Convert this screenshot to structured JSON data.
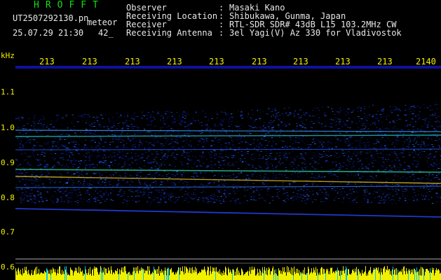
{
  "header": {
    "station_title": "HROFFT",
    "file_name": "UT2507292130.pn",
    "type_label": "meteor",
    "date_time": "25.07.29 21:30",
    "count": "42_"
  },
  "info": [
    {
      "label": "Observer",
      "value": "Masaki Kano"
    },
    {
      "label": "Receiving Location",
      "value": "Shibukawa, Gunma, Japan"
    },
    {
      "label": "Receiver",
      "value": "RTL-SDR SDR# 43dB L15 103.2MHz CW"
    },
    {
      "label": "Receiving Antenna",
      "value": "3el Yagi(V) Az 330 for Vladivostok"
    }
  ],
  "axis": {
    "unit": "kHz",
    "y_labels": [
      "1.1",
      "1.0",
      "0.9",
      "0.8",
      "0.7",
      "0.6"
    ],
    "x_labels": [
      "213",
      "213",
      "213",
      "213",
      "213",
      "213",
      "213",
      "213",
      "213",
      "2140"
    ]
  },
  "colors": {
    "text_green": "#10e010",
    "text_white": "#e8e8e8",
    "axis_yellow": "#f0f000",
    "background": "#000000",
    "signal_blue": "#1a2fd0",
    "echo_line": "#20c0c0",
    "indicator_bar": "#f0f000",
    "indicator_cyan": "#00c8f0"
  }
}
